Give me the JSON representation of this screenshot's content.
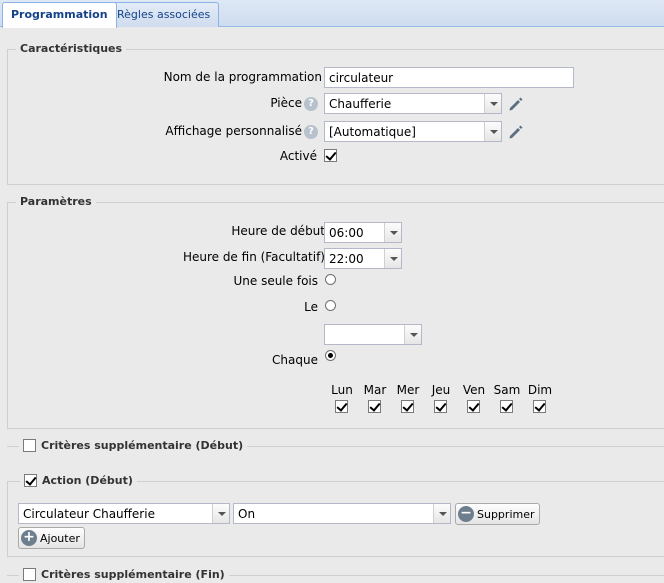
{
  "tabs": [
    {
      "label": "Programmation",
      "active": true
    },
    {
      "label": "Règles associées",
      "active": false
    }
  ],
  "caracteristiques": {
    "legend": "Caractéristiques",
    "nom_label": "Nom de la programmation",
    "nom_value": "circulateur",
    "piece_label": "Pièce",
    "piece_value": "Chaufferie",
    "affichage_label": "Affichage personnalisé",
    "affichage_value": "[Automatique]",
    "active_label": "Activé",
    "active_checked": true
  },
  "parametres": {
    "legend": "Paramètres",
    "debut_label": "Heure de début",
    "debut_value": "06:00",
    "fin_label": "Heure de fin (Facultatif)",
    "fin_value": "22:00",
    "une_fois_label": "Une seule fois",
    "le_label": "Le",
    "le_value": "",
    "chaque_label": "Chaque",
    "days": [
      {
        "label": "Lun",
        "checked": true
      },
      {
        "label": "Mar",
        "checked": true
      },
      {
        "label": "Mer",
        "checked": true
      },
      {
        "label": "Jeu",
        "checked": true
      },
      {
        "label": "Ven",
        "checked": true
      },
      {
        "label": "Sam",
        "checked": true
      },
      {
        "label": "Dim",
        "checked": true
      }
    ]
  },
  "criteres_debut": {
    "legend": "Critères supplémentaire (Début)",
    "checked": false
  },
  "action_debut": {
    "legend": "Action (Début)",
    "checked": true,
    "device_value": "Circulateur Chaufferie",
    "state_value": "On",
    "delete_label": "Supprimer",
    "add_label": "Ajouter"
  },
  "criteres_fin": {
    "legend": "Critères supplémentaire (Fin)",
    "checked": false
  },
  "icons": {
    "help": "?",
    "plus": "+",
    "minus": "−"
  },
  "colors": {
    "tab_text": "#15428b",
    "tab_border": "#99bbe8",
    "background": "#eaeaea"
  }
}
